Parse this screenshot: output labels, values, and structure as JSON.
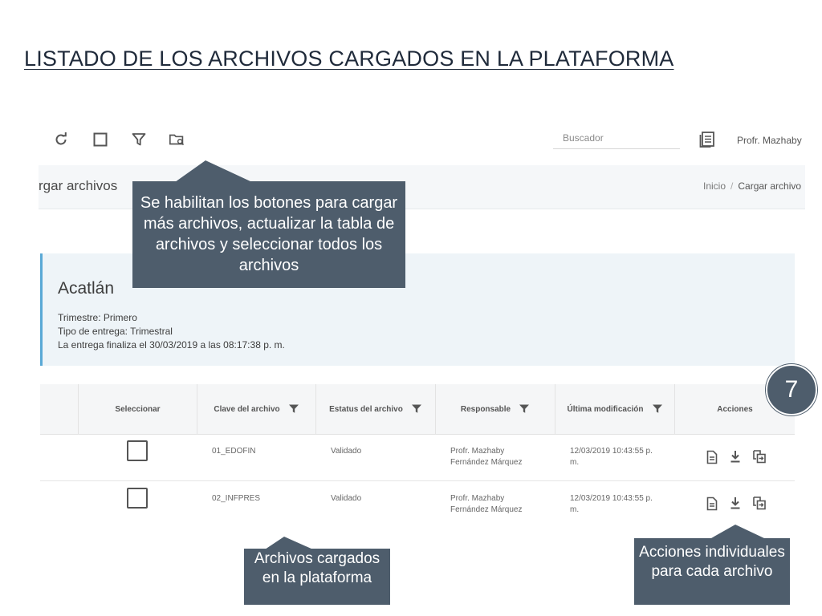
{
  "slide": {
    "title": "LISTADO DE LOS ARCHIVOS CARGADOS EN  LA PLATAFORMA",
    "step_number": "7"
  },
  "toolbar": {
    "icons": [
      "refresh-icon",
      "select-all-checkbox-icon",
      "filter-icon",
      "folder-search-icon"
    ],
    "search_placeholder": "Buscador",
    "user_icon": "document-list-icon",
    "user_name": "Profr. Mazhaby"
  },
  "page": {
    "heading": "rgar archivos",
    "breadcrumb": {
      "home": "Inicio",
      "separator": "/",
      "current": "Cargar archivo"
    }
  },
  "info": {
    "title": "Acatlán",
    "trimestre": "Trimestre: Primero",
    "tipo": "Tipo de entrega: Trimestral",
    "fin": "La entrega finaliza el 30/03/2019 a las 08:17:38 p. m."
  },
  "table": {
    "columns": [
      {
        "label": "Seleccionar",
        "filter": false
      },
      {
        "label": "Clave del archivo",
        "filter": true
      },
      {
        "label": "Estatus del archivo",
        "filter": true
      },
      {
        "label": "Responsable",
        "filter": true
      },
      {
        "label": "Última modificación",
        "filter": true
      },
      {
        "label": "Acciones",
        "filter": false
      }
    ],
    "rows": [
      {
        "clave": "01_EDOFIN",
        "estatus": "Validado",
        "responsable": "Profr. Mazhaby Fernández Márquez",
        "modificacion": "12/03/2019 10:43:55 p. m."
      },
      {
        "clave": "02_INFPRES",
        "estatus": "Validado",
        "responsable": "Profr. Mazhaby Fernández Márquez",
        "modificacion": "12/03/2019 10:43:55 p. m."
      }
    ],
    "action_icons": [
      "view-file-icon",
      "download-icon",
      "copy-file-icon"
    ]
  },
  "callouts": {
    "toolbar": "Se habilitan los botones para cargar más archivos, actualizar la tabla de archivos y seleccionar todos los archivos",
    "files": "Archivos cargados en la plataforma",
    "actions": "Acciones individuales para cada archivo"
  },
  "colors": {
    "callout_bg": "#4e5d6c",
    "info_accent": "#5aa9d6",
    "title_text": "#1f2a3a"
  }
}
